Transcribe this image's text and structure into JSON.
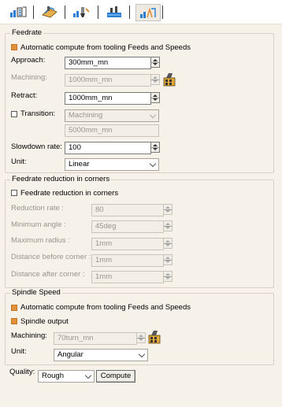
{
  "toolbar": {
    "tabs": [
      {
        "icon": "strategy-tab-icon"
      },
      {
        "icon": "geometry-tab-icon"
      },
      {
        "icon": "tool-tab-icon"
      },
      {
        "icon": "feeds-speeds-tab-icon"
      },
      {
        "icon": "macros-tab-icon"
      }
    ]
  },
  "feedrate": {
    "title": "Feedrate",
    "auto_compute_label": "Automatic compute from tooling Feeds and Speeds",
    "auto_compute_checked": true,
    "approach_label": "Approach:",
    "approach_value": "300mm_mn",
    "machining_label": "Machining:",
    "machining_value": "1000mm_mn",
    "retract_label": "Retract:",
    "retract_value": "1000mm_mn",
    "transition_label": "Transition:",
    "transition_checked": false,
    "transition_select": "Machining",
    "transition_value": "5000mm_mn",
    "slowdown_label": "Slowdown rate:",
    "slowdown_value": "100",
    "unit_label": "Unit:",
    "unit_value": "Linear"
  },
  "corners": {
    "title": "Feedrate reduction in corners",
    "checkbox_label": "Feedrate reduction in corners",
    "checkbox_checked": false,
    "reduction_rate_label": "Reduction rate :",
    "reduction_rate_value": "80",
    "min_angle_label": "Minimum angle :",
    "min_angle_value": "45deg",
    "max_radius_label": "Maximum radius :",
    "max_radius_value": "1mm",
    "dist_before_label": "Distance before corner :",
    "dist_before_value": "1mm",
    "dist_after_label": "Distance after corner :",
    "dist_after_value": "1mm"
  },
  "spindle": {
    "title": "Spindle Speed",
    "auto_compute_label": "Automatic compute from tooling Feeds and Speeds",
    "auto_compute_checked": true,
    "output_label": "Spindle output",
    "output_checked": true,
    "machining_label": "Machining:",
    "machining_value": "70turn_mn",
    "unit_label": "Unit:",
    "unit_value": "Angular"
  },
  "footer": {
    "quality_label": "Quality:",
    "quality_value": "Rough",
    "compute_label": "Compute"
  },
  "colors": {
    "background": "#f7f2e9",
    "checkbox_checked": "#e0913a"
  }
}
